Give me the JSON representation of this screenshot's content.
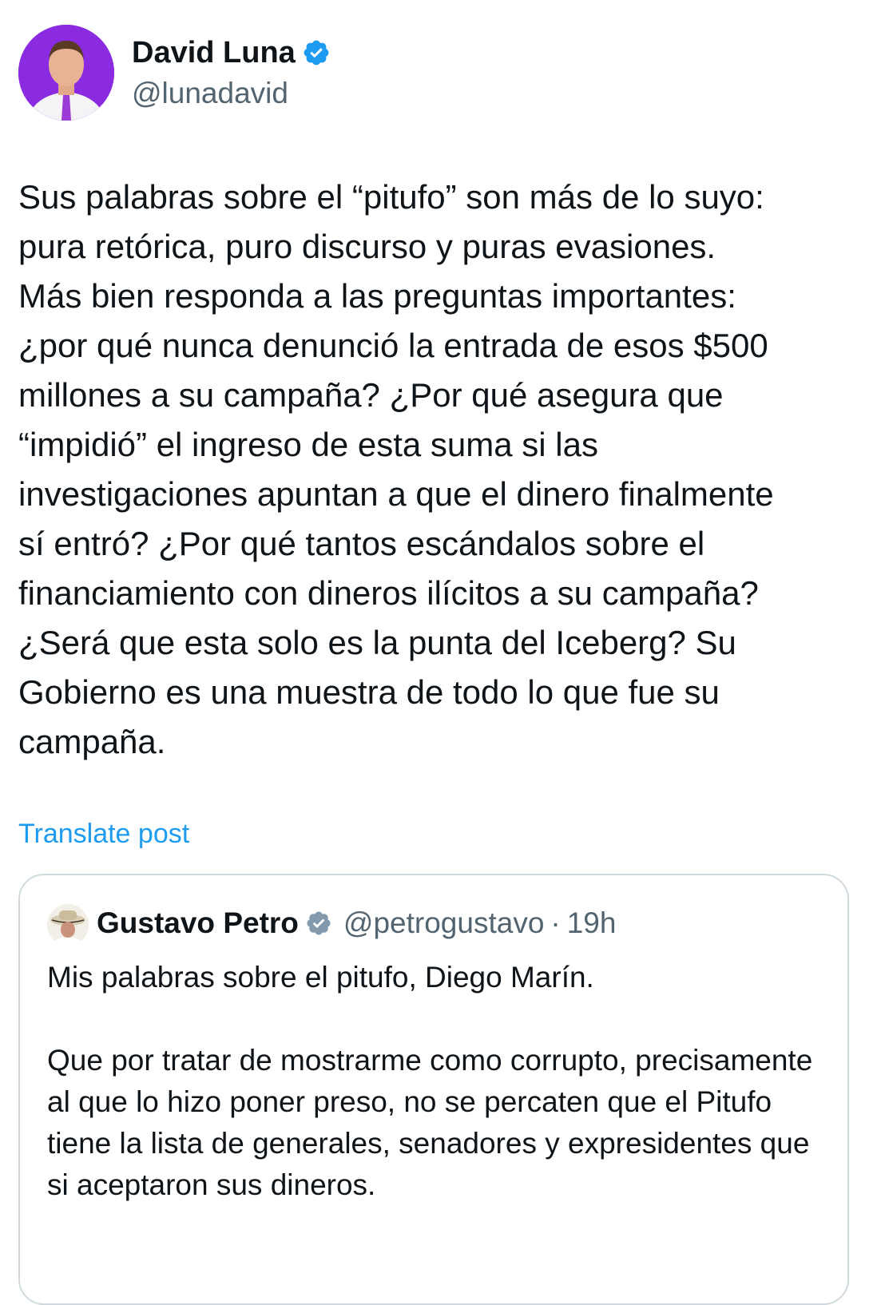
{
  "author": {
    "display_name": "David Luna",
    "handle": "@lunadavid",
    "verified": true
  },
  "post": {
    "text": "Sus palabras sobre el “pitufo” son más de lo suyo:\npura retórica, puro discurso y puras evasiones.\nMás bien responda a las preguntas importantes:\n¿por qué nunca denunció la entrada de esos $500\nmillones a su campaña? ¿Por qué asegura que\n“impidió” el ingreso de esta suma si las\ninvestigaciones apuntan a que el dinero finalmente\nsí entró? ¿Por qué tantos escándalos sobre el\nfinanciamiento con dineros ilícitos a su campaña?\n¿Será que esta solo es la punta del Iceberg? Su\nGobierno es una muestra de todo lo que fue su\ncampaña.",
    "translate_label": "Translate post"
  },
  "quoted_post": {
    "display_name": "Gustavo Petro",
    "handle": "@petrogustavo",
    "separator": "·",
    "time": "19h",
    "verified_badge": "gray",
    "paragraphs": [
      "Mis palabras sobre el pitufo, Diego Marín.",
      "Que por tratar de mostrarme como corrupto, precisamente al que lo hizo poner preso, no se percaten que el Pitufo tiene la lista de generales, senadores y expresidentes que si aceptaron sus dineros."
    ]
  },
  "colors": {
    "link_blue": "#1d9bf0",
    "verified_blue": "#1d9bf0",
    "verified_gray": "#829aab",
    "secondary_text": "#536471",
    "border": "#cfd9de"
  }
}
